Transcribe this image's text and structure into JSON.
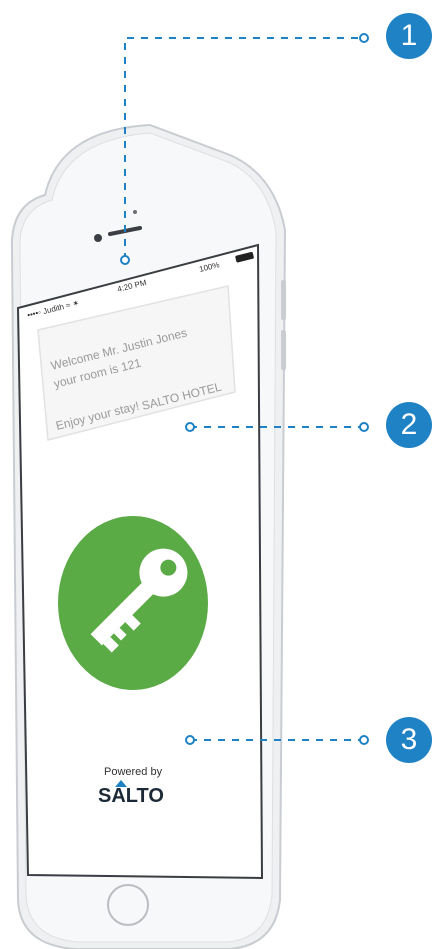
{
  "status_bar": {
    "carrier": "••••◦ Judith ≈ ✶",
    "time": "4:20 PM",
    "battery": "100%"
  },
  "card": {
    "line1": "Welcome Mr. Justin Jones",
    "line2": "your room is 121",
    "line3": "Enjoy your stay!",
    "hotel": "SALTO HOTEL"
  },
  "key_button": {
    "icon": "key-icon",
    "color": "#5aaa45"
  },
  "footer": {
    "powered_by": "Powered by",
    "brand": "SALTO",
    "brand_accent": "#1e82c4"
  },
  "callouts": [
    "1",
    "2",
    "3"
  ],
  "colors": {
    "callout": "#1e82c4",
    "key_circle": "#5aaa45"
  }
}
